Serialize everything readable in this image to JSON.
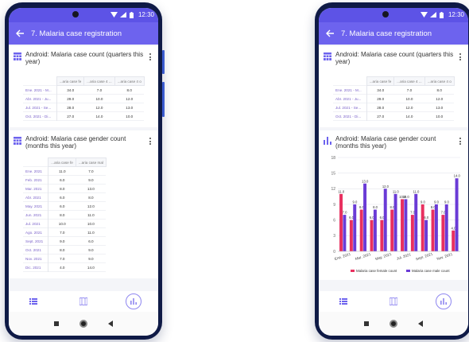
{
  "status_bar": {
    "time": "12:30"
  },
  "app_bar": {
    "title": "7. Malaria case registration"
  },
  "left_phone": {
    "card1": {
      "title": "Android: Malaria case count (quarters this year)",
      "columns": [
        "...aria case fe",
        "...aria case 4 ...",
        "...aria case 4 o"
      ],
      "rows": [
        {
          "label": "Ene. 2021 - M...",
          "values": [
            "34.0",
            "7.0",
            "8.0"
          ]
        },
        {
          "label": "Abr. 2021 - Ju...",
          "values": [
            "29.0",
            "10.0",
            "12.0"
          ]
        },
        {
          "label": "Jul. 2021 - Se...",
          "values": [
            "28.0",
            "12.0",
            "13.0"
          ]
        },
        {
          "label": "Oct. 2021 - Di...",
          "values": [
            "27.0",
            "14.0",
            "10.0"
          ]
        }
      ]
    },
    "card2": {
      "title": "Android: Malaria case gender count (months this year)",
      "columns": [
        "...aria case fe",
        "...aria case mal"
      ],
      "rows": [
        {
          "label": "Ene. 2021",
          "values": [
            "11.0",
            "7.0"
          ]
        },
        {
          "label": "Feb. 2021",
          "values": [
            "6.0",
            "9.0"
          ]
        },
        {
          "label": "Mar. 2021",
          "values": [
            "8.0",
            "13.0"
          ]
        },
        {
          "label": "Abr. 2021",
          "values": [
            "6.0",
            "8.0"
          ]
        },
        {
          "label": "May. 2021",
          "values": [
            "6.0",
            "12.0"
          ]
        },
        {
          "label": "Jun. 2021",
          "values": [
            "8.0",
            "11.0"
          ]
        },
        {
          "label": "Jul. 2021",
          "values": [
            "10.0",
            "10.0"
          ]
        },
        {
          "label": "Ago. 2021",
          "values": [
            "7.0",
            "11.0"
          ]
        },
        {
          "label": "Sept. 2021",
          "values": [
            "9.0",
            "6.0"
          ]
        },
        {
          "label": "Oct. 2021",
          "values": [
            "8.0",
            "9.0"
          ]
        },
        {
          "label": "Nov. 2021",
          "values": [
            "7.0",
            "9.0"
          ]
        },
        {
          "label": "Dic. 2021",
          "values": [
            "4.0",
            "14.0"
          ]
        }
      ]
    }
  },
  "right_phone": {
    "card1": {
      "title": "Android: Malaria case count (quarters this year)",
      "columns": [
        "...aria case fe",
        "...aria case 4 ...",
        "...aria case 4 o"
      ],
      "rows": [
        {
          "label": "Ene. 2021 - M...",
          "values": [
            "34.0",
            "7.0",
            "8.0"
          ]
        },
        {
          "label": "Abr. 2021 - Ju...",
          "values": [
            "29.0",
            "10.0",
            "12.0"
          ]
        },
        {
          "label": "Jul. 2021 - Se...",
          "values": [
            "28.0",
            "12.0",
            "13.0"
          ]
        },
        {
          "label": "Oct. 2021 - Di...",
          "values": [
            "27.0",
            "14.0",
            "10.0"
          ]
        }
      ]
    },
    "card2": {
      "title": "Android: Malaria case gender count (months this year)"
    }
  },
  "chart_data": {
    "type": "bar",
    "categories": [
      "Ene. 2021",
      "Feb. 2021",
      "Mar. 2021",
      "Abr. 2021",
      "May. 2021",
      "Jun. 2021",
      "Jul. 2021",
      "Ago. 2021",
      "Sept. 2021",
      "Oct. 2021",
      "Nov. 2021",
      "Dic. 2021"
    ],
    "tick_labels": [
      "Ene. 2021",
      "Mar. 2021",
      "May. 2021",
      "Jul. 2021",
      "Sept. 2021",
      "Nov. 2021"
    ],
    "series": [
      {
        "name": "Malaria case female count",
        "values": [
          11,
          6,
          8,
          6,
          6,
          8,
          10,
          7,
          9,
          8,
          7,
          4
        ],
        "color": "#e8305f"
      },
      {
        "name": "Malaria case male count",
        "values": [
          7,
          9,
          13,
          8,
          12,
          11,
          10,
          11,
          6,
          9,
          9,
          14
        ],
        "color": "#6a3bd6"
      }
    ],
    "yticks": [
      0,
      3,
      6,
      9,
      12,
      15,
      18
    ],
    "ylim": [
      0,
      18
    ],
    "legend_position": "bottom",
    "grid": true
  },
  "colors": {
    "primary": "#6d63ee",
    "status_bar": "#5d53e6",
    "frame": "#0f1a46",
    "female": "#e8305f",
    "male": "#6a3bd6"
  },
  "nav_icons": [
    "list-icon",
    "map-icon",
    "chart-icon"
  ]
}
